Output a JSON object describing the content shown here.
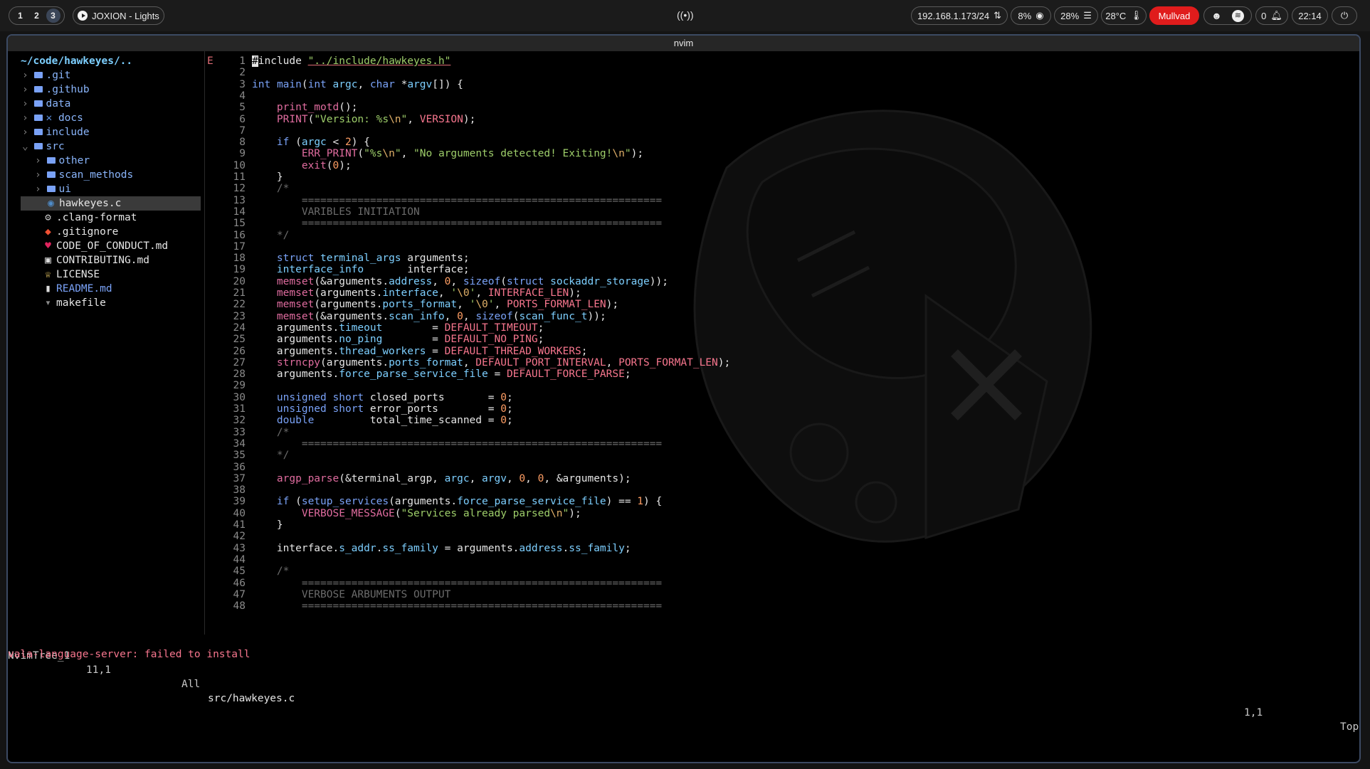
{
  "topbar": {
    "workspaces": [
      "1",
      "2",
      "3"
    ],
    "active_workspace": "3",
    "media_title": "JOXION - Lights",
    "ip": "192.168.1.173/24",
    "cpu": "8%",
    "mem": "28%",
    "temp": "28°C",
    "vpn": "Mullvad",
    "notifications": "0",
    "clock": "22:14"
  },
  "window": {
    "title": "nvim"
  },
  "tree": {
    "root": "~/code/hawkeyes/..",
    "items": [
      {
        "label": ".git",
        "kind": "dir",
        "chev": "›",
        "depth": 0
      },
      {
        "label": ".github",
        "kind": "dir",
        "chev": "›",
        "depth": 0
      },
      {
        "label": "data",
        "kind": "dir",
        "chev": "›",
        "depth": 0
      },
      {
        "label": "docs",
        "kind": "dir",
        "chev": "›",
        "depth": 0,
        "prefix": "✕ "
      },
      {
        "label": "include",
        "kind": "dir",
        "chev": "›",
        "depth": 0
      },
      {
        "label": "src",
        "kind": "dir",
        "chev": "⌄",
        "depth": 0
      },
      {
        "label": "other",
        "kind": "dir",
        "chev": "›",
        "depth": 1
      },
      {
        "label": "scan_methods",
        "kind": "dir",
        "chev": "›",
        "depth": 1
      },
      {
        "label": "ui",
        "kind": "dir",
        "chev": "›",
        "depth": 1
      },
      {
        "label": "hawkeyes.c",
        "kind": "file",
        "depth": 1,
        "icon": "c-icon",
        "selected": true
      },
      {
        "label": ".clang-format",
        "kind": "file",
        "depth": 0,
        "icon": "gear-icon"
      },
      {
        "label": ".gitignore",
        "kind": "file",
        "depth": 0,
        "icon": "git-icon"
      },
      {
        "label": "CODE_OF_CONDUCT.md",
        "kind": "file",
        "depth": 0,
        "icon": "heart-icon"
      },
      {
        "label": "CONTRIBUTING.md",
        "kind": "file",
        "depth": 0,
        "icon": "markdown-icon"
      },
      {
        "label": "LICENSE",
        "kind": "file",
        "depth": 0,
        "icon": "license-icon"
      },
      {
        "label": "README.md",
        "kind": "file",
        "depth": 0,
        "icon": "readme-icon",
        "color": "#7aa2f7"
      },
      {
        "label": "makefile",
        "kind": "file",
        "depth": 0,
        "icon": "make-icon"
      }
    ]
  },
  "editor": {
    "sign_text": "E",
    "lines": [
      "#include \"../include/hawkeyes.h\"",
      "",
      "int main(int argc, char *argv[]) {",
      "",
      "    print_motd();",
      "    PRINT(\"Version: %s\\n\", VERSION);",
      "",
      "    if (argc < 2) {",
      "        ERR_PRINT(\"%s\\n\", \"No arguments detected! Exiting!\\n\");",
      "        exit(0);",
      "    }",
      "    /*",
      "        ==========================================================",
      "        VARIBLES INITIATION",
      "        ==========================================================",
      "    */",
      "",
      "    struct terminal_args arguments;",
      "    interface_info       interface;",
      "    memset(&arguments.address, 0, sizeof(struct sockaddr_storage));",
      "    memset(arguments.interface, '\\0', INTERFACE_LEN);",
      "    memset(arguments.ports_format, '\\0', PORTS_FORMAT_LEN);",
      "    memset(&arguments.scan_info, 0, sizeof(scan_func_t));",
      "    arguments.timeout        = DEFAULT_TIMEOUT;",
      "    arguments.no_ping        = DEFAULT_NO_PING;",
      "    arguments.thread_workers = DEFAULT_THREAD_WORKERS;",
      "    strncpy(arguments.ports_format, DEFAULT_PORT_INTERVAL, PORTS_FORMAT_LEN);",
      "    arguments.force_parse_service_file = DEFAULT_FORCE_PARSE;",
      "",
      "    unsigned short closed_ports       = 0;",
      "    unsigned short error_ports        = 0;",
      "    double         total_time_scanned = 0;",
      "    /*",
      "        ==========================================================",
      "    */",
      "",
      "    argp_parse(&terminal_argp, argc, argv, 0, 0, &arguments);",
      "",
      "    if (setup_services(arguments.force_parse_service_file) == 1) {",
      "        VERBOSE_MESSAGE(\"Services already parsed\\n\");",
      "    }",
      "",
      "    interface.s_addr.ss_family = arguments.address.ss_family;",
      "",
      "    /*",
      "        ==========================================================",
      "        VERBOSE ARBUMENTS OUTPUT",
      "        =========================================================="
    ]
  },
  "statusline": {
    "left_name": "NvimTree_1",
    "left_pos": "11,1",
    "left_scroll": "All",
    "file": "src/hawkeyes.c",
    "right_pos": "1,1",
    "right_scroll": "Top"
  },
  "message": "vala-language-server: failed to install"
}
